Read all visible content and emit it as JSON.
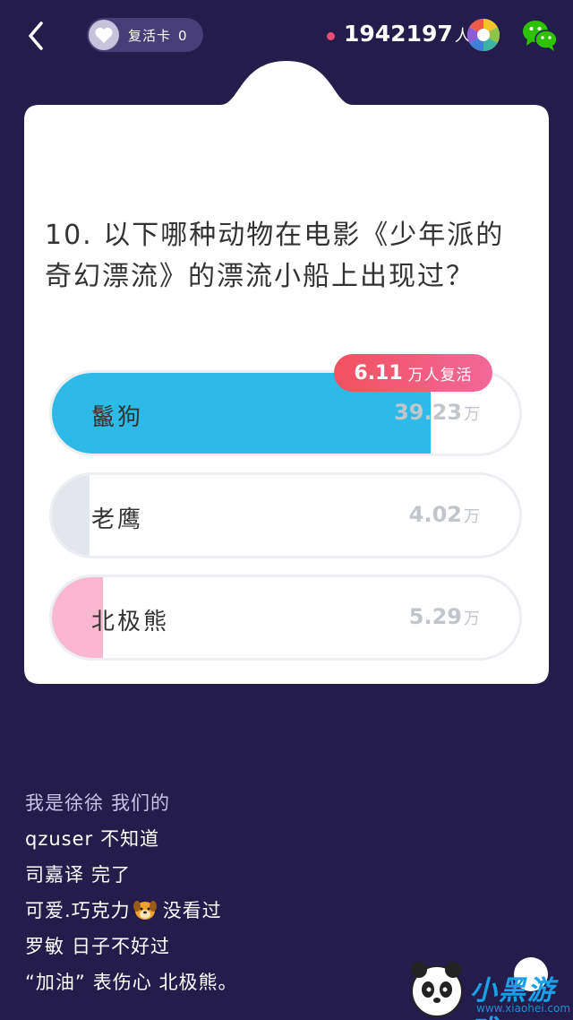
{
  "header": {
    "revive_card_label": "复活卡",
    "revive_card_count": "0",
    "online_count": "1942197",
    "online_unit": "人"
  },
  "question": {
    "text_line1": "10. 以下哪种动物在电影《少年派的",
    "text_line2": "奇幻漂流》的漂流小船上出现过？"
  },
  "revive_badge": {
    "value": "6.11",
    "unit": "万人复活"
  },
  "options": [
    {
      "label": "鬣狗",
      "count": "39.23",
      "unit": "万",
      "fill_fraction": 0.81,
      "fill_color": "#2ebae6"
    },
    {
      "label": "老鹰",
      "count": "4.02",
      "unit": "万",
      "fill_fraction": 0.08,
      "fill_color": "#e3e6ec"
    },
    {
      "label": "北极熊",
      "count": "5.29",
      "unit": "万",
      "fill_fraction": 0.11,
      "fill_color": "#f9b8cf"
    }
  ],
  "comments": [
    {
      "user": "我是徐徐",
      "text": "我们的",
      "dim": true
    },
    {
      "user": "qzuser",
      "text": "不知道",
      "dim": false
    },
    {
      "user": "司嘉译",
      "text": "完了",
      "dim": false
    },
    {
      "user": "可爱.巧克力",
      "text": "没看过",
      "dim": false,
      "emoji": "dog-face"
    },
    {
      "user": "罗敏",
      "text": "日子不好过",
      "dim": false
    },
    {
      "user": "“加油”",
      "text": "表伤心 北极熊。",
      "dim": false
    }
  ],
  "watermark": {
    "text": "小黑游戏",
    "url": "www.xiaohei.com"
  },
  "colors": {
    "background": "#241c4a",
    "correct_fill": "#2ebae6",
    "badge": "#f2515e"
  }
}
